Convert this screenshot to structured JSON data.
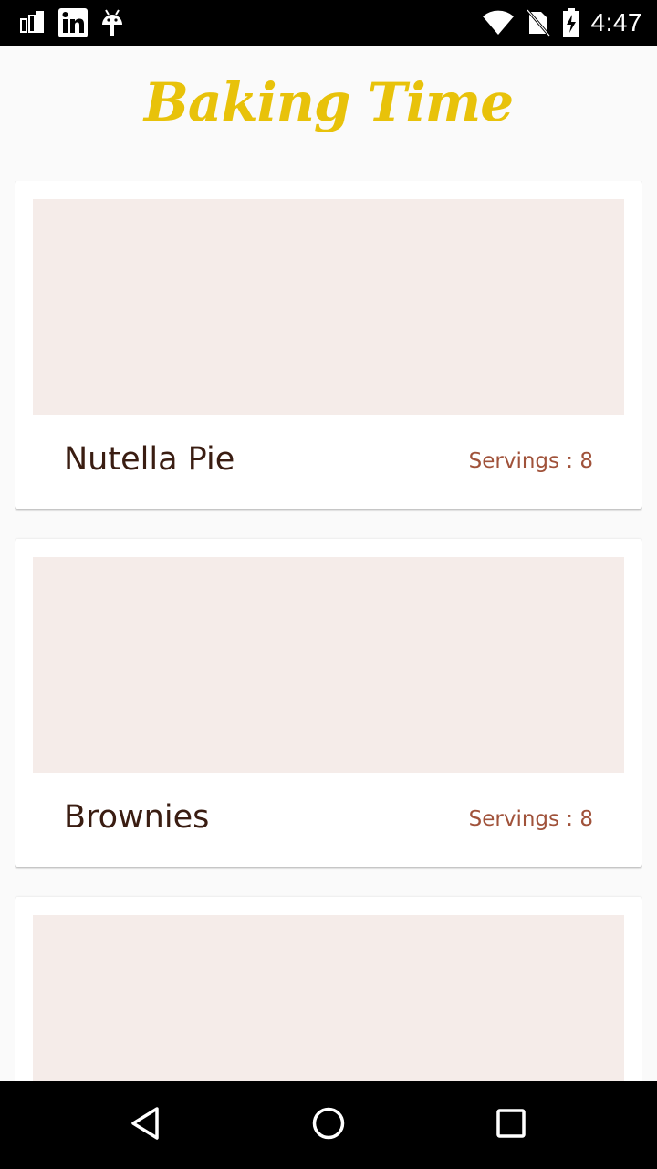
{
  "status_bar": {
    "time": "4:47",
    "icons_left": [
      "sim-stack-icon",
      "linkedin-icon",
      "android-icon"
    ],
    "icons_right": [
      "wifi-icon",
      "no-sim-icon",
      "battery-charging-icon"
    ]
  },
  "app_bar": {
    "title": "Baking Time",
    "title_color": "#e8c20a"
  },
  "recipes": [
    {
      "name": "Nutella Pie",
      "servings": "Servings : 8"
    },
    {
      "name": "Brownies",
      "servings": "Servings : 8"
    },
    {
      "name": "",
      "servings": ""
    }
  ],
  "colors": {
    "placeholder": "#f5ece9",
    "name_text": "#3a1d12",
    "servings_text": "#a0523a"
  },
  "nav_bar": {
    "buttons": [
      "back-icon",
      "home-icon",
      "recents-icon"
    ]
  }
}
